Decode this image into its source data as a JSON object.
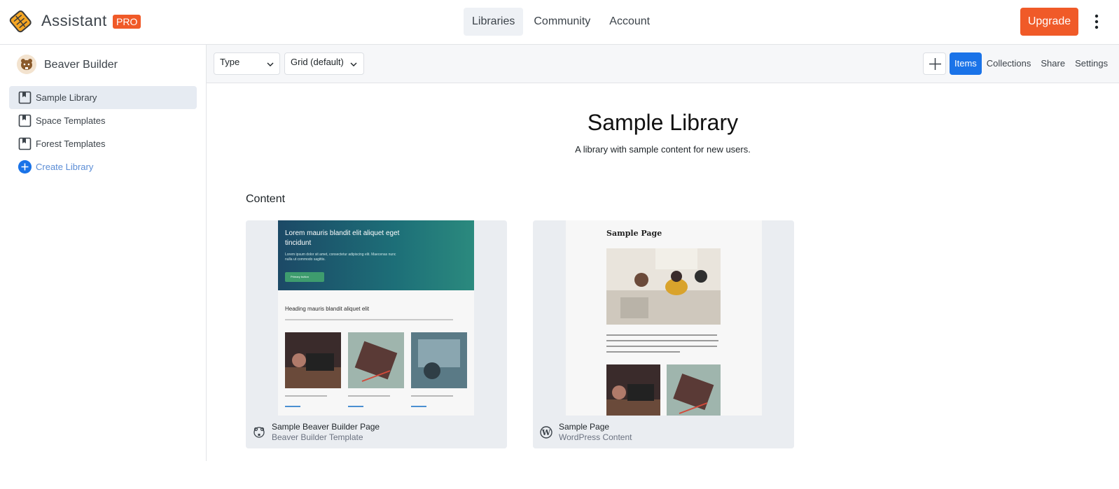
{
  "app": {
    "brand": "Assistant",
    "badge": "PRO"
  },
  "nav": {
    "items": [
      {
        "label": "Libraries",
        "active": true
      },
      {
        "label": "Community",
        "active": false
      },
      {
        "label": "Account",
        "active": false
      }
    ],
    "upgrade_label": "Upgrade"
  },
  "sidebar": {
    "brand_label": "Beaver Builder",
    "items": [
      {
        "label": "Sample Library",
        "active": true
      },
      {
        "label": "Space Templates",
        "active": false
      },
      {
        "label": "Forest Templates",
        "active": false
      }
    ],
    "create_label": "Create Library"
  },
  "toolbar": {
    "type_select": "Type",
    "view_select": "Grid (default)",
    "tabs": [
      {
        "label": "Items",
        "active": true
      },
      {
        "label": "Collections",
        "active": false
      },
      {
        "label": "Share",
        "active": false
      },
      {
        "label": "Settings",
        "active": false
      }
    ]
  },
  "main": {
    "title": "Sample Library",
    "subtitle": "A library with sample content for new users.",
    "section_title": "Content",
    "cards": [
      {
        "title": "Sample Beaver Builder Page",
        "subtitle": "Beaver Builder Template",
        "icon": "beaver-icon",
        "preview": {
          "hero_title": "Lorem mauris blandit elit aliquet eget tincidunt",
          "hero_text": "Lorem ipsum dolor sit amet, consectetur adipiscing elit. Maecenas nunc nulla ut commodo sagittis.",
          "hero_button": "Primary button",
          "heading": "Heading mauris blandit aliquet elit"
        }
      },
      {
        "title": "Sample Page",
        "subtitle": "WordPress Content",
        "icon": "wordpress-icon",
        "preview": {
          "page_title": "Sample Page"
        }
      }
    ]
  },
  "colors": {
    "accent": "#1a73e8",
    "brand_orange": "#f05a28"
  }
}
